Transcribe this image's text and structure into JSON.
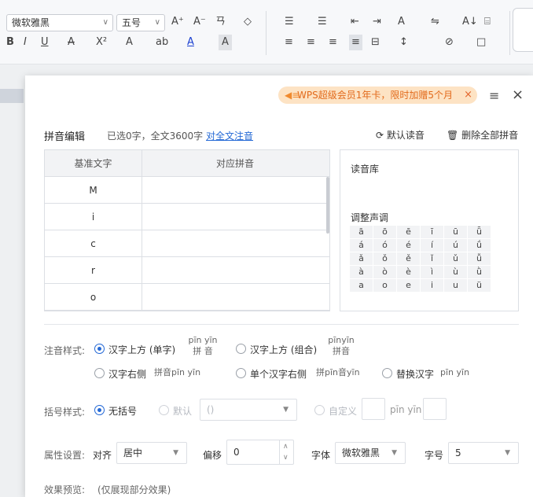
{
  "toolbar": {
    "font_name": "微软雅黑",
    "font_size": "五号",
    "row1_icons": [
      "A⁺",
      "A⁻",
      "ㄢ",
      "◇"
    ],
    "row2_icons": [
      "B",
      "I",
      "U",
      "A",
      "X²",
      "A",
      "ab",
      "A",
      "A"
    ],
    "para_row1": [
      "☰",
      "☰",
      "⇤",
      "⇥",
      "A",
      "⇋",
      "A↓",
      "⌸"
    ],
    "para_row2": [
      "≡",
      "≡",
      "≡",
      "≡",
      "⊟",
      "↕",
      "⊘",
      "□"
    ]
  },
  "dialog": {
    "promo_text": "WPS超级会员1年卡，限时加赠5个月",
    "promo_close": "×",
    "menu_icon_glyph": "≡",
    "close_glyph": "×",
    "section_title": "拼音编辑",
    "selection_info": "已选0字，全文3600字",
    "full_annotation_link": "对全文注音",
    "default_reading_label": "默认读音",
    "delete_all_label": "删除全部拼音",
    "table": {
      "headers": [
        "基准文字",
        "对应拼音"
      ],
      "rows": [
        {
          "base": "M",
          "pinyin": ""
        },
        {
          "base": "i",
          "pinyin": ""
        },
        {
          "base": "c",
          "pinyin": ""
        },
        {
          "base": "r",
          "pinyin": ""
        },
        {
          "base": "o",
          "pinyin": ""
        }
      ]
    },
    "reading_library_label": "读音库",
    "adjust_tone_label": "调整声调",
    "tones": [
      [
        "ā",
        "ō",
        "ē",
        "ī",
        "ū",
        "ǖ"
      ],
      [
        "á",
        "ó",
        "é",
        "í",
        "ú",
        "ǘ"
      ],
      [
        "ǎ",
        "ǒ",
        "ě",
        "ǐ",
        "ǔ",
        "ǚ"
      ],
      [
        "à",
        "ò",
        "è",
        "ì",
        "ù",
        "ǜ"
      ],
      [
        "a",
        "o",
        "e",
        "i",
        "u",
        "ü"
      ]
    ],
    "annotation_style": {
      "label": "注音样式:",
      "opt_above_single": "汉字上方 (单字)",
      "opt_above_single_preview_top": "pīn yīn",
      "opt_above_single_preview_bottom": "拼 音",
      "opt_above_group": "汉字上方 (组合)",
      "opt_above_group_preview_top": "pīnyīn",
      "opt_above_group_preview_bottom": "拼音",
      "opt_right": "汉字右侧",
      "opt_right_preview": "拼音pīn yīn",
      "opt_right_each": "单个汉字右侧",
      "opt_right_each_preview": "拼pīn音yīn",
      "opt_replace": "替换汉字",
      "opt_replace_preview": "pīn yīn"
    },
    "bracket_style": {
      "label": "括号样式:",
      "opt_none": "无括号",
      "opt_default": "默认",
      "default_value": "()",
      "opt_custom": "自定义",
      "custom_preview": "pīn yīn"
    },
    "attributes": {
      "label": "属性设置:",
      "align_label": "对齐",
      "align_value": "居中",
      "offset_label": "偏移",
      "offset_value": "0",
      "font_label": "字体",
      "font_value": "微软雅黑",
      "size_label": "字号",
      "size_value": "5"
    },
    "preview": {
      "label": "效果预览:",
      "note": "(仅展现部分效果)"
    }
  }
}
